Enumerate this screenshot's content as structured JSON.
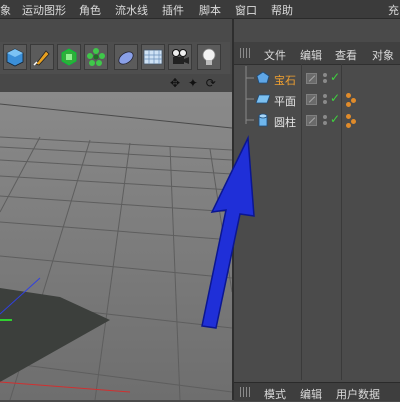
{
  "menubar": {
    "items": [
      {
        "label": "象"
      },
      {
        "label": "运动图形"
      },
      {
        "label": "角色"
      },
      {
        "label": "流水线"
      },
      {
        "label": "插件"
      },
      {
        "label": "脚本"
      },
      {
        "label": "窗口"
      },
      {
        "label": "帮助"
      }
    ],
    "right_label": "充"
  },
  "toolbar": {
    "buttons": [
      {
        "icon": "cube-icon"
      },
      {
        "icon": "pen-icon"
      },
      {
        "icon": "subdivision-icon"
      },
      {
        "icon": "cloner-icon"
      },
      {
        "icon": "deformer-icon"
      },
      {
        "icon": "floor-icon"
      },
      {
        "icon": "camera-icon"
      },
      {
        "icon": "light-icon"
      }
    ]
  },
  "viewport": {
    "nav_icons": "✥ ✦ ⟳ ◫"
  },
  "object_manager": {
    "menu": [
      {
        "label": "文件"
      },
      {
        "label": "编辑"
      },
      {
        "label": "查看"
      },
      {
        "label": "对象"
      }
    ],
    "objects": [
      {
        "label": "宝石",
        "selected": true
      },
      {
        "label": "平面",
        "selected": false
      },
      {
        "label": "圆柱",
        "selected": false
      }
    ]
  },
  "attributes_bar": {
    "items": [
      {
        "label": "模式"
      },
      {
        "label": "编辑"
      },
      {
        "label": "用户数据"
      }
    ]
  },
  "colors": {
    "selected_text": "#f0a030",
    "check": "#3fd13f",
    "annotation_arrow": "#1f2fd8",
    "tag_orange": "#e08b2a"
  }
}
